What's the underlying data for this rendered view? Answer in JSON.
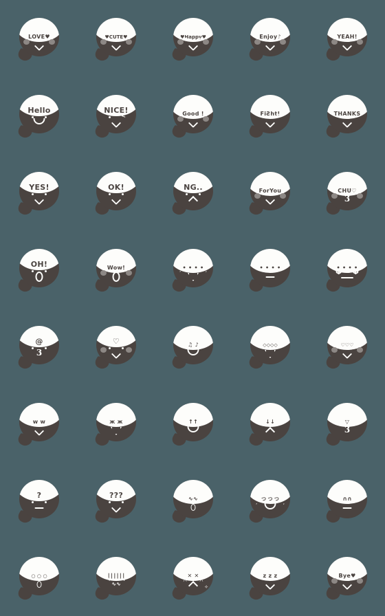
{
  "sheet": {
    "title": "Emoji Sticker Sheet",
    "background_color": "#4a6269",
    "body_color": "#4a4340",
    "cap_color": "#fdfdfb",
    "blush_color": "#8d8885",
    "columns": 5,
    "rows": 8,
    "total": 40
  },
  "emojis": [
    {
      "id": "e1",
      "cap": "LOVE♥",
      "name": "love",
      "cap_size": "sm",
      "blush": true,
      "eyes": "dots",
      "mouth": "v-smile"
    },
    {
      "id": "e2",
      "cap": "♥CUTE♥",
      "name": "cute",
      "cap_size": "xs",
      "blush": true,
      "eyes": "dots",
      "mouth": "v-smile"
    },
    {
      "id": "e3",
      "cap": "♥Happy♥",
      "name": "happy",
      "cap_size": "xs",
      "blush": true,
      "eyes": "glyph",
      "eye_l": ">",
      "eye_r": "<",
      "mouth": "v-smile"
    },
    {
      "id": "e4",
      "cap": "Enjoy♪",
      "name": "enjoy",
      "cap_size": "sm",
      "blush": true,
      "eyes": "mixed",
      "eye_r": "<",
      "mouth": "v-smile"
    },
    {
      "id": "e5",
      "cap": "YEAH!",
      "name": "yeah",
      "cap_size": "sm",
      "blush": true,
      "eyes": "dots",
      "mouth": "v-smile"
    },
    {
      "id": "e6",
      "cap": "Hello",
      "name": "hello",
      "cap_size": "big",
      "blush": false,
      "eyes": "dots",
      "mouth": "u-smile"
    },
    {
      "id": "e7",
      "cap": "NICE!",
      "name": "nice",
      "cap_size": "big",
      "blush": false,
      "eyes": "mixed",
      "eye_r": "<",
      "mouth": "v-smile"
    },
    {
      "id": "e8",
      "cap": "Good !",
      "name": "good",
      "cap_size": "sm",
      "blush": true,
      "eyes": "dots",
      "mouth": "v-smile"
    },
    {
      "id": "e9",
      "cap": "FiƧht!",
      "name": "fight",
      "cap_size": "sm",
      "blush": false,
      "eyes": "mixed",
      "eye_r": "<",
      "mouth": "v-smile"
    },
    {
      "id": "e10",
      "cap": "THANKS",
      "name": "thanks",
      "cap_size": "sm",
      "blush": false,
      "eyes": "dots",
      "mouth": "v-smile"
    },
    {
      "id": "e11",
      "cap": "YES!",
      "name": "yes",
      "cap_size": "big",
      "blush": false,
      "eyes": "dots",
      "mouth": "v-smile"
    },
    {
      "id": "e12",
      "cap": "OK!",
      "name": "ok",
      "cap_size": "big",
      "blush": false,
      "eyes": "dots",
      "mouth": "v-smile"
    },
    {
      "id": "e13",
      "cap": "NG..",
      "name": "ng",
      "cap_size": "big",
      "blush": false,
      "eyes": "dots",
      "mouth": "frown"
    },
    {
      "id": "e14",
      "cap": "ForYou",
      "name": "for-you",
      "cap_size": "sm",
      "blush": true,
      "eyes": "dots",
      "mouth": "v-smile"
    },
    {
      "id": "e15",
      "cap": "CHU♡",
      "name": "chu-kiss",
      "cap_size": "sm",
      "blush": true,
      "eyes": "dots",
      "mouth": "three"
    },
    {
      "id": "e16",
      "cap": "OH!",
      "name": "oh",
      "cap_size": "big",
      "blush": false,
      "eyes": "dots",
      "mouth": "oval"
    },
    {
      "id": "e17",
      "cap": "Wow!",
      "name": "wow",
      "cap_size": "sm",
      "blush": true,
      "eyes": "dots",
      "mouth": "oval"
    },
    {
      "id": "e18",
      "cap": "• • • •",
      "name": "dots-triangle",
      "cap_size": "sm",
      "blush": false,
      "eyes": "sweatdots",
      "mouth": "tri-open"
    },
    {
      "id": "e19",
      "cap": "• • • •",
      "name": "dots-flat",
      "cap_size": "sm",
      "blush": false,
      "eyes": "dots",
      "mouth": "flat"
    },
    {
      "id": "e20",
      "cap": "• • • •",
      "name": "dots-spiral",
      "cap_size": "sm",
      "blush": false,
      "eyes": "spiral",
      "mouth": "flat-wide"
    },
    {
      "id": "e21",
      "cap": "@",
      "name": "whistle-spiral",
      "cap_size": "big",
      "blush": false,
      "eyes": "dots",
      "mouth": "three"
    },
    {
      "id": "e22",
      "cap": "♡",
      "name": "heart",
      "cap_size": "big",
      "blush": true,
      "eyes": "dots",
      "mouth": "v-smile"
    },
    {
      "id": "e23",
      "cap": "♫ ♪",
      "name": "music",
      "cap_size": "sm",
      "blush": false,
      "eyes": "dots",
      "mouth": "u-smile"
    },
    {
      "id": "e24",
      "cap": "◇◇◇◇",
      "name": "sparkle",
      "cap_size": "xs",
      "blush": false,
      "eyes": "dots",
      "mouth": "tri-open"
    },
    {
      "id": "e25",
      "cap": "♡♡♡",
      "name": "hearts",
      "cap_size": "xs",
      "blush": true,
      "eyes": "dots",
      "mouth": "v-smile"
    },
    {
      "id": "e26",
      "cap": "w w",
      "name": "laughing-www",
      "cap_size": "sm",
      "blush": false,
      "eyes": "dots",
      "mouth": "v-smile"
    },
    {
      "id": "e27",
      "cap": "ж ж",
      "name": "angry-marks",
      "cap_size": "sm",
      "blush": false,
      "eyes": "dots",
      "mouth": "tri-open"
    },
    {
      "id": "e28",
      "cap": "↑↑",
      "name": "arrows-up",
      "cap_size": "sm",
      "blush": false,
      "eyes": "dots",
      "mouth": "u-smile"
    },
    {
      "id": "e29",
      "cap": "↓↓",
      "name": "arrows-down",
      "cap_size": "sm",
      "blush": false,
      "eyes": "sad",
      "mouth": "frown"
    },
    {
      "id": "e30",
      "cap": "▽",
      "name": "tornado",
      "cap_size": "sm",
      "blush": false,
      "eyes": "dots",
      "mouth": "three"
    },
    {
      "id": "e31",
      "cap": "?",
      "name": "question",
      "cap_size": "big",
      "blush": false,
      "eyes": "dots",
      "mouth": "flat"
    },
    {
      "id": "e32",
      "cap": "???",
      "name": "questions",
      "cap_size": "big",
      "blush": false,
      "eyes": "dots",
      "mouth": "v-smile"
    },
    {
      "id": "e33",
      "cap": "∿∿",
      "name": "squiggle",
      "cap_size": "sm",
      "blush": false,
      "eyes": "dots",
      "mouth": "oval-sm"
    },
    {
      "id": "e34",
      "cap": "つ つ つ",
      "name": "sweat-drops",
      "cap_size": "xs",
      "blush": false,
      "eyes": "dots",
      "mouth": "u-smile",
      "sweat": true
    },
    {
      "id": "e35",
      "cap": "∩∩",
      "name": "worried-brows",
      "cap_size": "sm",
      "blush": false,
      "eyes": "dots",
      "mouth": "flat"
    },
    {
      "id": "e36",
      "cap": "○ ○ ○",
      "name": "shock-sweat",
      "cap_size": "xs",
      "blush": false,
      "eyes": "dots",
      "mouth": "oval-sm"
    },
    {
      "id": "e37",
      "cap": "∣∣∣∣∣∣",
      "name": "despair-lines",
      "cap_size": "sm",
      "blush": false,
      "eyes": "squiggle",
      "mouth": "wavy"
    },
    {
      "id": "e38",
      "cap": "✕ ✕",
      "name": "crying-x",
      "cap_size": "sm",
      "blush": false,
      "eyes": "xeyes",
      "mouth": "frown",
      "spark": true
    },
    {
      "id": "e39",
      "cap": "z z z",
      "name": "sleeping",
      "cap_size": "sm",
      "blush": false,
      "eyes": "dots",
      "mouth": "v-smile"
    },
    {
      "id": "e40",
      "cap": "Bye♥",
      "name": "bye",
      "cap_size": "sm",
      "blush": true,
      "eyes": "dots",
      "mouth": "v-smile"
    }
  ]
}
